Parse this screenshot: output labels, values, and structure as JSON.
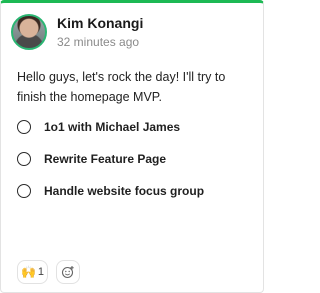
{
  "post": {
    "author": "Kim Konangi",
    "time": "32 minutes ago",
    "message": "Hello guys, let's rock the day! I'll try to finish the homepage MVP."
  },
  "checklist": [
    {
      "label": "1o1 with Michael James",
      "checked": false
    },
    {
      "label": "Rewrite Feature Page",
      "checked": false
    },
    {
      "label": "Handle website focus group",
      "checked": false
    }
  ],
  "reactions": {
    "raised_hands": {
      "emoji": "🙌",
      "count": "1"
    },
    "add_reaction_icon": "add-reaction-icon"
  },
  "colors": {
    "accent": "#1db954",
    "avatar_ring": "#2bb673"
  }
}
